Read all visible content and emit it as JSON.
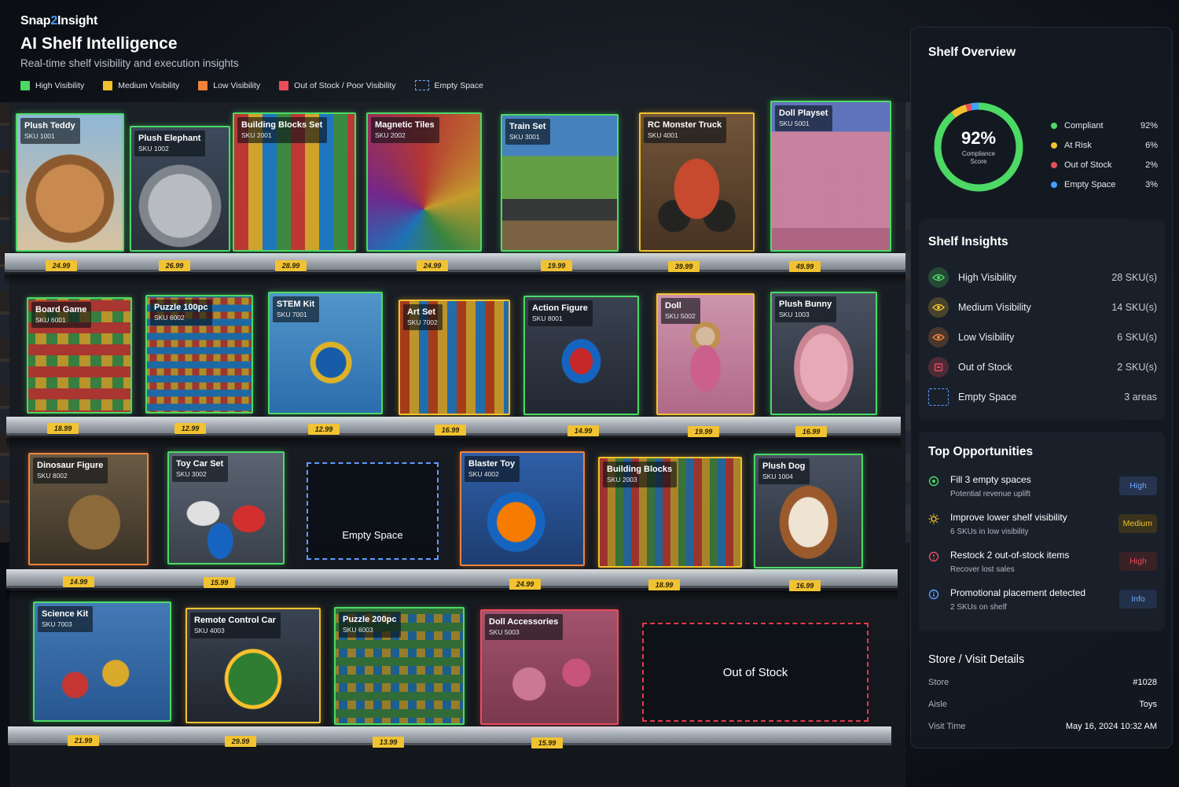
{
  "brand": {
    "name_a": "Snap",
    "name_num": "2",
    "name_b": "Insight"
  },
  "title": "AI Shelf Intelligence",
  "subtitle": "Real-time shelf visibility and execution insights",
  "colors": {
    "high": "#4cd964",
    "medium": "#f2c12e",
    "low": "#f0823a",
    "out_of_stock": "#ea4c5b",
    "empty": "#5e9dff",
    "accent": "#3fa3ff"
  },
  "legend": [
    {
      "label": "High Visibility",
      "color": "#4cd964"
    },
    {
      "label": "Medium Visibility",
      "color": "#f2c12e"
    },
    {
      "label": "Low Visibility",
      "color": "#f0823a"
    },
    {
      "label": "Out of Stock / Poor Visibility",
      "color": "#ea4c5b"
    },
    {
      "label": "Empty Space",
      "color": "#5e9dff"
    }
  ],
  "shelves": [
    {
      "products": [
        {
          "name": "Plush Teddy",
          "sku": "SKU 1001",
          "status": "high"
        },
        {
          "name": "Plush Elephant",
          "sku": "SKU 1002",
          "status": "high"
        },
        {
          "name": "Building Blocks Set",
          "sku": "SKU 2001",
          "status": "high"
        },
        {
          "name": "Magnetic Tiles",
          "sku": "SKU 2002",
          "status": "high"
        },
        {
          "name": "Train Set",
          "sku": "SKU 3001",
          "status": "high"
        },
        {
          "name": "RC Monster Truck",
          "sku": "SKU 4001",
          "status": "medium"
        },
        {
          "name": "Doll Playset",
          "sku": "SKU 5001",
          "status": "high"
        }
      ],
      "prices": [
        "24.99",
        "26.99",
        "28.99",
        "24.99",
        "19.99",
        "39.99",
        "49.99"
      ]
    },
    {
      "products": [
        {
          "name": "Board Game",
          "sku": "SKU 6001",
          "status": "high"
        },
        {
          "name": "Puzzle 100pc",
          "sku": "SKU 6002",
          "status": "high"
        },
        {
          "name": "STEM Kit",
          "sku": "SKU 7001",
          "status": "high"
        },
        {
          "name": "Art Set",
          "sku": "SKU 7002",
          "status": "medium"
        },
        {
          "name": "Action Figure",
          "sku": "SKU 8001",
          "status": "high"
        },
        {
          "name": "Doll",
          "sku": "SKU 5002",
          "status": "medium"
        },
        {
          "name": "Plush Bunny",
          "sku": "SKU 1003",
          "status": "high"
        }
      ],
      "prices": [
        "18.99",
        "12.99",
        "12.99",
        "16.99",
        "14.99",
        "19.99",
        "16.99"
      ]
    },
    {
      "products": [
        {
          "name": "Dinosaur Figure",
          "sku": "SKU 8002",
          "status": "low"
        },
        {
          "name": "Toy Car Set",
          "sku": "SKU 3002",
          "status": "high"
        },
        {
          "name": "Blaster Toy",
          "sku": "SKU 4002",
          "status": "low"
        },
        {
          "name": "Building Blocks",
          "sku": "SKU 2003",
          "status": "medium"
        },
        {
          "name": "Plush Dog",
          "sku": "SKU 1004",
          "status": "high"
        }
      ],
      "empty_label": "Empty Space",
      "prices": [
        "14.99",
        "15.99",
        "24.99",
        "18.99",
        "16.99"
      ]
    },
    {
      "products": [
        {
          "name": "Science Kit",
          "sku": "SKU 7003",
          "status": "high"
        },
        {
          "name": "Remote Control Car",
          "sku": "SKU 4003",
          "status": "medium"
        },
        {
          "name": "Puzzle 200pc",
          "sku": "SKU 6003",
          "status": "high"
        },
        {
          "name": "Doll Accessories",
          "sku": "SKU 5003",
          "status": "oos"
        }
      ],
      "oos_label": "Out of Stock",
      "prices": [
        "21.99",
        "29.99",
        "13.99",
        "15.99"
      ]
    }
  ],
  "overview": {
    "title": "Shelf Overview",
    "score": "92%",
    "score_label_1": "Compliance",
    "score_label_2": "Score",
    "score_value": 92,
    "items": [
      {
        "label": "Compliant",
        "pct": "92%",
        "value": 92,
        "color": "#4cd964"
      },
      {
        "label": "At Risk",
        "pct": "6%",
        "value": 6,
        "color": "#f2c12e"
      },
      {
        "label": "Out of Stock",
        "pct": "2%",
        "value": 2,
        "color": "#ea4c5b"
      },
      {
        "label": "Empty Space",
        "pct": "3%",
        "value": 3,
        "color": "#3fa3ff"
      }
    ]
  },
  "insights": {
    "title": "Shelf Insights",
    "rows": [
      {
        "label": "High Visibility",
        "count": "28 SKU(s)",
        "icon": "eye-icon",
        "color": "#4cd964"
      },
      {
        "label": "Medium Visibility",
        "count": "14 SKU(s)",
        "icon": "eye-icon",
        "color": "#f2c12e"
      },
      {
        "label": "Low Visibility",
        "count": "6 SKU(s)",
        "icon": "eye-icon",
        "color": "#f0823a"
      },
      {
        "label": "Out of Stock",
        "count": "2 SKU(s)",
        "icon": "box-icon",
        "color": "#ea4c5b"
      },
      {
        "label": "Empty Space",
        "count": "3 areas",
        "icon": "dashed-square-icon",
        "color": "#5e9dff"
      }
    ]
  },
  "opportunities": {
    "title": "Top Opportunities",
    "rows": [
      {
        "title": "Fill 3 empty spaces",
        "sub": "Potential revenue uplift",
        "badge": "High",
        "icon": "target-icon"
      },
      {
        "title": "Improve lower shelf visibility",
        "sub": "6 SKUs in low visibility",
        "badge": "Medium",
        "icon": "sun-icon"
      },
      {
        "title": "Restock 2 out-of-stock items",
        "sub": "Recover lost sales",
        "badge": "High",
        "icon": "alert-icon"
      },
      {
        "title": "Promotional placement detected",
        "sub": "2 SKUs on shelf",
        "badge": "Info",
        "icon": "info-icon"
      }
    ]
  },
  "details": {
    "title": "Store / Visit Details",
    "rows": [
      {
        "key": "Store",
        "value": "#1028"
      },
      {
        "key": "Aisle",
        "value": "Toys"
      },
      {
        "key": "Visit Time",
        "value": "May 16, 2024 10:32 AM"
      }
    ]
  }
}
